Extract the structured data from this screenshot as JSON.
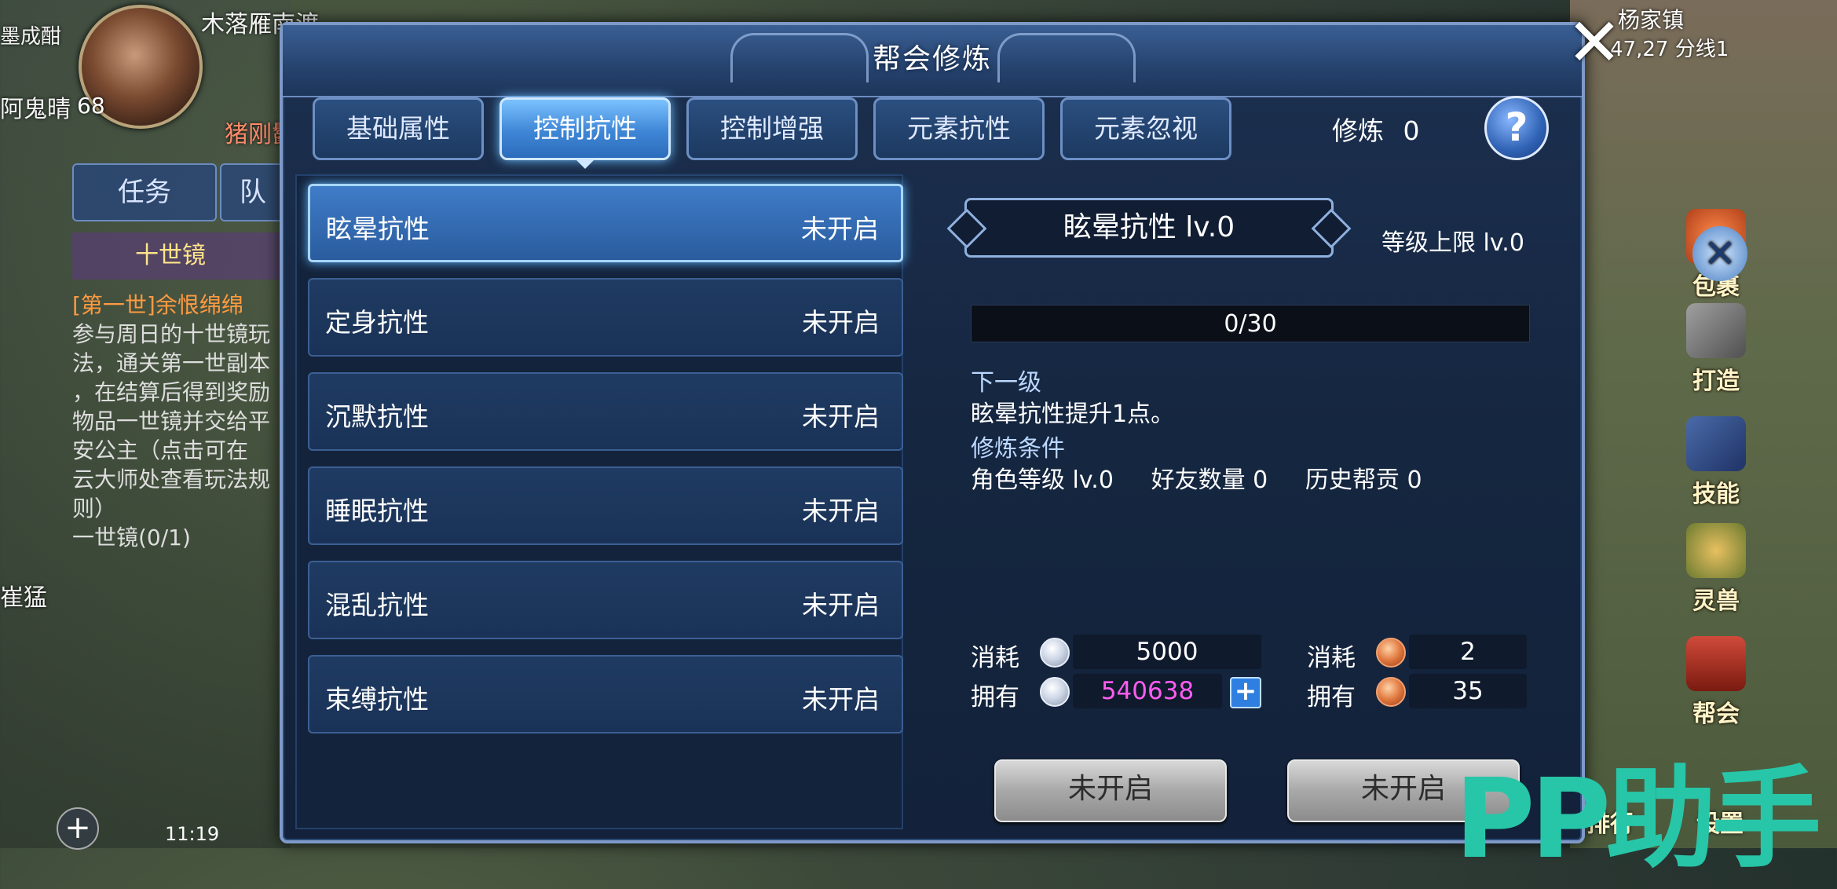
{
  "hud": {
    "player_name": "木落雁南渡",
    "player_level": "68",
    "pet_name": "猪刚鬣",
    "top_left_text": "墨成酣",
    "side_name": "阿鬼晴",
    "task_tab": "任务",
    "team_tab": "队",
    "quest_title": "十世镜",
    "quest_body": [
      {
        "text": "[第一世]余恨绵绵",
        "color": "orange"
      },
      {
        "text": "参与周日的十世镜玩",
        "color": "white"
      },
      {
        "text": "法，通关第一世副本",
        "color": "white"
      },
      {
        "text": "，在结算后得到奖励",
        "color": "white"
      },
      {
        "text": "物品一世镜并交给平",
        "color": "white"
      },
      {
        "text": "安公主（点击可在",
        "color": "white"
      },
      {
        "text": "云大师处查看玩法规",
        "color": "white"
      },
      {
        "text": "则）",
        "color": "white"
      },
      {
        "text": "一世镜(0/1)",
        "color": "white"
      }
    ],
    "bottom_left_name": "崔猛",
    "time": "11:19",
    "map_name": "杨家镇",
    "map_coord": "47,27 分线1",
    "side_buttons": [
      {
        "label": "包裹",
        "icon": "bag-icon"
      },
      {
        "label": "打造",
        "icon": "forge-icon"
      },
      {
        "label": "技能",
        "icon": "skill-book-icon"
      },
      {
        "label": "灵兽",
        "icon": "spirit-beast-icon"
      },
      {
        "label": "帮会",
        "icon": "guild-icon"
      }
    ],
    "bottom_right_labels": [
      "排行",
      "设置"
    ],
    "watermark": "PP助手"
  },
  "panel": {
    "title": "帮会修炼",
    "tabs": [
      {
        "label": "基础属性",
        "active": false
      },
      {
        "label": "控制抗性",
        "active": true
      },
      {
        "label": "控制增强",
        "active": false
      },
      {
        "label": "元素抗性",
        "active": false
      },
      {
        "label": "元素忽视",
        "active": false
      }
    ],
    "xiulian_label": "修炼",
    "xiulian_value": "0",
    "help_label": "?",
    "list": [
      {
        "name": "眩晕抗性",
        "state": "未开启",
        "selected": true
      },
      {
        "name": "定身抗性",
        "state": "未开启",
        "selected": false
      },
      {
        "name": "沉默抗性",
        "state": "未开启",
        "selected": false
      },
      {
        "name": "睡眠抗性",
        "state": "未开启",
        "selected": false
      },
      {
        "name": "混乱抗性",
        "state": "未开启",
        "selected": false
      },
      {
        "name": "束缚抗性",
        "state": "未开启",
        "selected": false
      }
    ],
    "detail": {
      "skill_title": "眩晕抗性    lv.0",
      "level_cap": "等级上限 lv.0",
      "progress_text": "0/30",
      "progress_fraction": 0,
      "next_level_label": "下一级",
      "next_level_text": "眩晕抗性提升1点。",
      "conditions_label": "修炼条件",
      "conditions_text": "角色等级 lv.0     好友数量 0     历史帮贡 0",
      "cost_label": "消耗",
      "own_label": "拥有",
      "silver_cost": "5000",
      "silver_own": "540638",
      "copper_cost": "2",
      "copper_own": "35",
      "button_left": "未开启",
      "button_right": "未开启"
    }
  }
}
